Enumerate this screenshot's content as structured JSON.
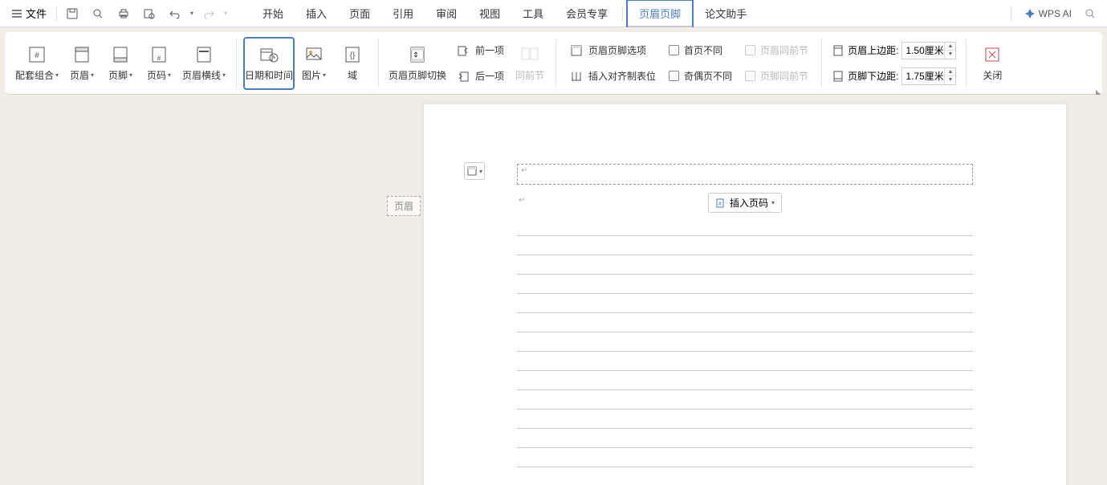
{
  "menubar": {
    "file": "文件",
    "tabs": [
      "开始",
      "插入",
      "页面",
      "引用",
      "审阅",
      "视图",
      "工具",
      "会员专享",
      "页眉页脚",
      "论文助手"
    ],
    "active_tab": "页眉页脚",
    "wps_ai": "WPS AI"
  },
  "ribbon": {
    "group1": {
      "combo": "配套组合",
      "header": "页眉",
      "footer": "页脚",
      "pageno": "页码",
      "headerline": "页眉横线"
    },
    "group2": {
      "datetime": "日期和时间",
      "picture": "图片",
      "field": "域"
    },
    "group3": {
      "switch": "页眉页脚切换",
      "prev": "前一项",
      "next": "后一项",
      "same": "同前节"
    },
    "group4": {
      "options": "页眉页脚选项",
      "align": "插入对齐制表位",
      "first_diff": "首页不同",
      "odd_even": "奇偶页不同",
      "header_same": "页眉同前节",
      "footer_same": "页脚同前节"
    },
    "group5": {
      "top_label": "页眉上边距:",
      "top_value": "1.50厘米",
      "bottom_label": "页脚下边距:",
      "bottom_value": "1.75厘米"
    },
    "group6": {
      "close": "关闭"
    }
  },
  "canvas": {
    "header_tab": "页眉",
    "insert_pageno": "插入页码"
  }
}
